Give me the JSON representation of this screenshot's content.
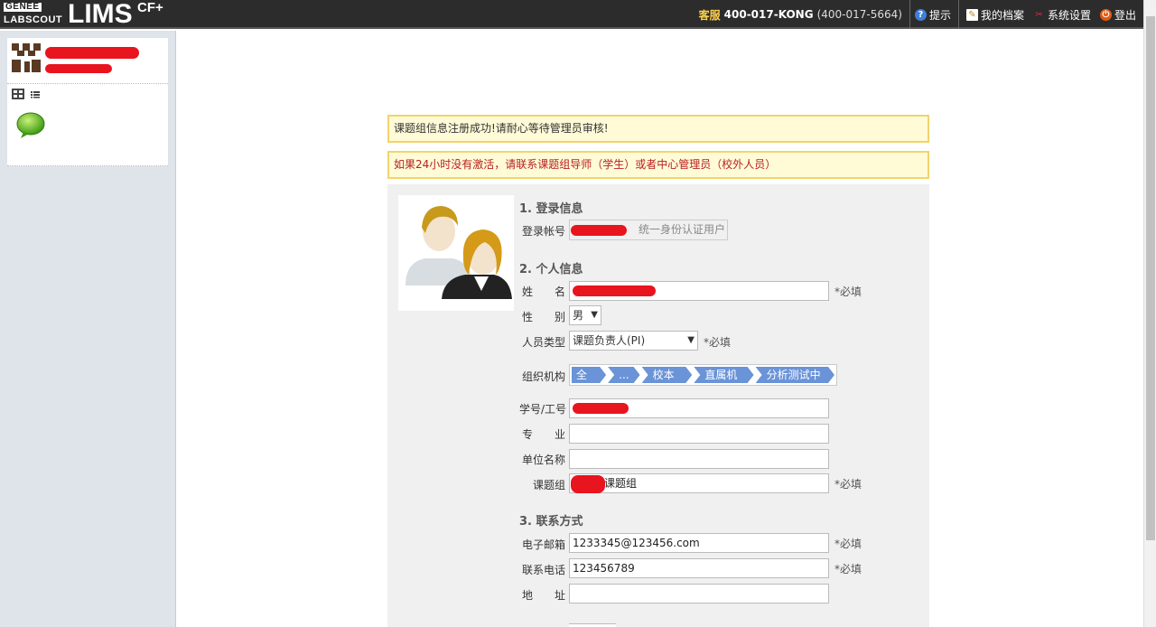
{
  "brand": {
    "top": "GENEE",
    "bottom": "LABSCOUT",
    "name": "LIMS",
    "suffix": "CF+"
  },
  "topbar": {
    "support_label": "客服",
    "support_number": "400-017-KONG",
    "support_number_alt": "(400-017-5664)",
    "hint": "提示",
    "profile": "我的档案",
    "settings": "系统设置",
    "logout": "登出"
  },
  "notices": {
    "success": "课题组信息注册成功!请耐心等待管理员审核!",
    "warning": "如果24小时没有激活，请联系课题组导师（学生）或者中心管理员（校外人员）"
  },
  "form": {
    "section1": "1. 登录信息",
    "login_label": "登录帐号",
    "login_suffix": "统一身份认证用户",
    "section2": "2. 个人信息",
    "name_label": "姓　　名",
    "required": "*必填",
    "gender_label": "性　　别",
    "gender_value": "男",
    "type_label": "人员类型",
    "type_value": "课题负责人(PI)",
    "org_label": "组织机构",
    "org_path": [
      "全部",
      "...",
      "校本部",
      "直属机构",
      "分析测试中心"
    ],
    "id_label": "学号/工号",
    "major_label": "专　　业",
    "unit_label": "单位名称",
    "group_label": "课题组",
    "group_value": "课题组",
    "section3": "3. 联系方式",
    "email_label": "电子邮箱",
    "email_value": "1233345@123456.com",
    "phone_label": "联系电话",
    "phone_value": "123456789",
    "address_label": "地　　址"
  },
  "colors": {
    "accent": "#6a93d8",
    "redaction": "#e8141e",
    "notice_border": "#f2d36c",
    "warning_text": "#b82020"
  }
}
